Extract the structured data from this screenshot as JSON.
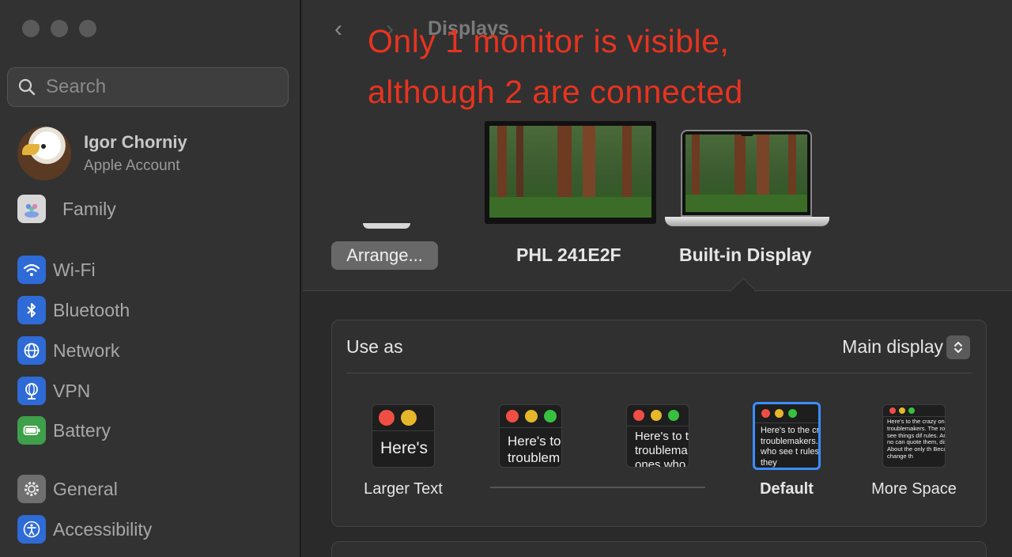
{
  "window": {
    "title": "Displays"
  },
  "annotation": {
    "line1": "Only 1 monitor is visible,",
    "line2": "although 2 are connected"
  },
  "sidebar": {
    "search_placeholder": "Search",
    "account": {
      "name": "Igor Chorniy",
      "subtitle": "Apple Account"
    },
    "items": [
      {
        "label": "Family",
        "icon": "family-icon"
      },
      {
        "label": "Wi-Fi",
        "icon": "wifi-icon",
        "color": "#2f6bd6"
      },
      {
        "label": "Bluetooth",
        "icon": "bluetooth-icon",
        "color": "#2f6bd6"
      },
      {
        "label": "Network",
        "icon": "network-icon",
        "color": "#2f6bd6"
      },
      {
        "label": "VPN",
        "icon": "vpn-icon",
        "color": "#2f6bd6"
      },
      {
        "label": "Battery",
        "icon": "battery-icon",
        "color": "#3ea04a"
      },
      {
        "label": "General",
        "icon": "gear-icon",
        "color": "#6f6f6f"
      },
      {
        "label": "Accessibility",
        "icon": "accessibility-icon",
        "color": "#2f6bd6"
      }
    ]
  },
  "displays": {
    "arrange_label": "Arrange...",
    "items": [
      {
        "name": "PHL 241E2F",
        "type": "external-monitor"
      },
      {
        "name": "Built-in Display",
        "type": "laptop",
        "selected": true
      }
    ]
  },
  "settings": {
    "use_as": {
      "label": "Use as",
      "value": "Main display"
    },
    "resolution": {
      "options": [
        {
          "label": "Larger Text",
          "sample": "Here's"
        },
        {
          "label": "",
          "sample": "Here's to troublem"
        },
        {
          "label": "",
          "sample": "Here's to t troublema ones who"
        },
        {
          "label": "Default",
          "sample": "Here's to the cr troublemakers. ones who see t rules. And they",
          "selected": true
        },
        {
          "label": "More Space",
          "sample": "Here's to the crazy one troublemakers. The rou ones who see things dif rules. And they have no can quote them, disagr them. About the only th Because they change th"
        }
      ],
      "selected_color": "#3d8dff"
    }
  },
  "colors": {
    "annotation": "#e8331f",
    "accent": "#3d8dff"
  }
}
